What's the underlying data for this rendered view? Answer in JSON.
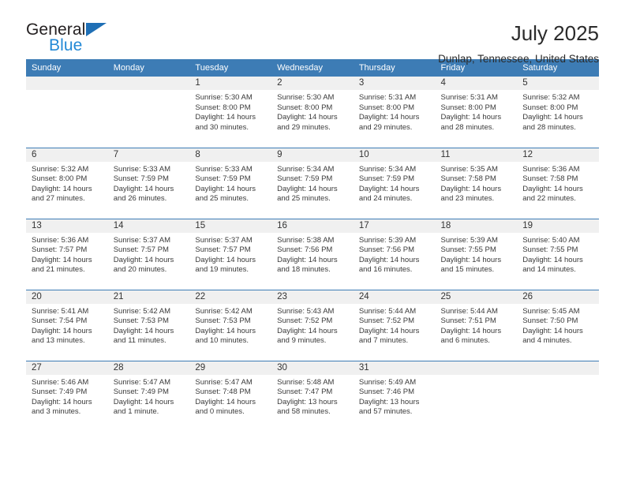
{
  "branding": {
    "word_one": "General",
    "word_two": "Blue",
    "triangle_color": "#1f6fb5",
    "blue_text_color": "#2389d6",
    "dark_text_color": "#231f20"
  },
  "header": {
    "title": "July 2025",
    "subtitle": "Dunlap, Tennessee, United States"
  },
  "theme": {
    "header_blue": "#3d7cb5",
    "daynum_band": "#f0f0f0",
    "text": "#3a3a3a"
  },
  "calendar": {
    "weekday_headers": [
      "Sunday",
      "Monday",
      "Tuesday",
      "Wednesday",
      "Thursday",
      "Friday",
      "Saturday"
    ],
    "weeks": [
      [
        {
          "day": "",
          "sunrise": "",
          "sunset": "",
          "daylight": ""
        },
        {
          "day": "",
          "sunrise": "",
          "sunset": "",
          "daylight": ""
        },
        {
          "day": "1",
          "sunrise": "Sunrise: 5:30 AM",
          "sunset": "Sunset: 8:00 PM",
          "daylight": "Daylight: 14 hours and 30 minutes."
        },
        {
          "day": "2",
          "sunrise": "Sunrise: 5:30 AM",
          "sunset": "Sunset: 8:00 PM",
          "daylight": "Daylight: 14 hours and 29 minutes."
        },
        {
          "day": "3",
          "sunrise": "Sunrise: 5:31 AM",
          "sunset": "Sunset: 8:00 PM",
          "daylight": "Daylight: 14 hours and 29 minutes."
        },
        {
          "day": "4",
          "sunrise": "Sunrise: 5:31 AM",
          "sunset": "Sunset: 8:00 PM",
          "daylight": "Daylight: 14 hours and 28 minutes."
        },
        {
          "day": "5",
          "sunrise": "Sunrise: 5:32 AM",
          "sunset": "Sunset: 8:00 PM",
          "daylight": "Daylight: 14 hours and 28 minutes."
        }
      ],
      [
        {
          "day": "6",
          "sunrise": "Sunrise: 5:32 AM",
          "sunset": "Sunset: 8:00 PM",
          "daylight": "Daylight: 14 hours and 27 minutes."
        },
        {
          "day": "7",
          "sunrise": "Sunrise: 5:33 AM",
          "sunset": "Sunset: 7:59 PM",
          "daylight": "Daylight: 14 hours and 26 minutes."
        },
        {
          "day": "8",
          "sunrise": "Sunrise: 5:33 AM",
          "sunset": "Sunset: 7:59 PM",
          "daylight": "Daylight: 14 hours and 25 minutes."
        },
        {
          "day": "9",
          "sunrise": "Sunrise: 5:34 AM",
          "sunset": "Sunset: 7:59 PM",
          "daylight": "Daylight: 14 hours and 25 minutes."
        },
        {
          "day": "10",
          "sunrise": "Sunrise: 5:34 AM",
          "sunset": "Sunset: 7:59 PM",
          "daylight": "Daylight: 14 hours and 24 minutes."
        },
        {
          "day": "11",
          "sunrise": "Sunrise: 5:35 AM",
          "sunset": "Sunset: 7:58 PM",
          "daylight": "Daylight: 14 hours and 23 minutes."
        },
        {
          "day": "12",
          "sunrise": "Sunrise: 5:36 AM",
          "sunset": "Sunset: 7:58 PM",
          "daylight": "Daylight: 14 hours and 22 minutes."
        }
      ],
      [
        {
          "day": "13",
          "sunrise": "Sunrise: 5:36 AM",
          "sunset": "Sunset: 7:57 PM",
          "daylight": "Daylight: 14 hours and 21 minutes."
        },
        {
          "day": "14",
          "sunrise": "Sunrise: 5:37 AM",
          "sunset": "Sunset: 7:57 PM",
          "daylight": "Daylight: 14 hours and 20 minutes."
        },
        {
          "day": "15",
          "sunrise": "Sunrise: 5:37 AM",
          "sunset": "Sunset: 7:57 PM",
          "daylight": "Daylight: 14 hours and 19 minutes."
        },
        {
          "day": "16",
          "sunrise": "Sunrise: 5:38 AM",
          "sunset": "Sunset: 7:56 PM",
          "daylight": "Daylight: 14 hours and 18 minutes."
        },
        {
          "day": "17",
          "sunrise": "Sunrise: 5:39 AM",
          "sunset": "Sunset: 7:56 PM",
          "daylight": "Daylight: 14 hours and 16 minutes."
        },
        {
          "day": "18",
          "sunrise": "Sunrise: 5:39 AM",
          "sunset": "Sunset: 7:55 PM",
          "daylight": "Daylight: 14 hours and 15 minutes."
        },
        {
          "day": "19",
          "sunrise": "Sunrise: 5:40 AM",
          "sunset": "Sunset: 7:55 PM",
          "daylight": "Daylight: 14 hours and 14 minutes."
        }
      ],
      [
        {
          "day": "20",
          "sunrise": "Sunrise: 5:41 AM",
          "sunset": "Sunset: 7:54 PM",
          "daylight": "Daylight: 14 hours and 13 minutes."
        },
        {
          "day": "21",
          "sunrise": "Sunrise: 5:42 AM",
          "sunset": "Sunset: 7:53 PM",
          "daylight": "Daylight: 14 hours and 11 minutes."
        },
        {
          "day": "22",
          "sunrise": "Sunrise: 5:42 AM",
          "sunset": "Sunset: 7:53 PM",
          "daylight": "Daylight: 14 hours and 10 minutes."
        },
        {
          "day": "23",
          "sunrise": "Sunrise: 5:43 AM",
          "sunset": "Sunset: 7:52 PM",
          "daylight": "Daylight: 14 hours and 9 minutes."
        },
        {
          "day": "24",
          "sunrise": "Sunrise: 5:44 AM",
          "sunset": "Sunset: 7:52 PM",
          "daylight": "Daylight: 14 hours and 7 minutes."
        },
        {
          "day": "25",
          "sunrise": "Sunrise: 5:44 AM",
          "sunset": "Sunset: 7:51 PM",
          "daylight": "Daylight: 14 hours and 6 minutes."
        },
        {
          "day": "26",
          "sunrise": "Sunrise: 5:45 AM",
          "sunset": "Sunset: 7:50 PM",
          "daylight": "Daylight: 14 hours and 4 minutes."
        }
      ],
      [
        {
          "day": "27",
          "sunrise": "Sunrise: 5:46 AM",
          "sunset": "Sunset: 7:49 PM",
          "daylight": "Daylight: 14 hours and 3 minutes."
        },
        {
          "day": "28",
          "sunrise": "Sunrise: 5:47 AM",
          "sunset": "Sunset: 7:49 PM",
          "daylight": "Daylight: 14 hours and 1 minute."
        },
        {
          "day": "29",
          "sunrise": "Sunrise: 5:47 AM",
          "sunset": "Sunset: 7:48 PM",
          "daylight": "Daylight: 14 hours and 0 minutes."
        },
        {
          "day": "30",
          "sunrise": "Sunrise: 5:48 AM",
          "sunset": "Sunset: 7:47 PM",
          "daylight": "Daylight: 13 hours and 58 minutes."
        },
        {
          "day": "31",
          "sunrise": "Sunrise: 5:49 AM",
          "sunset": "Sunset: 7:46 PM",
          "daylight": "Daylight: 13 hours and 57 minutes."
        },
        {
          "day": "",
          "sunrise": "",
          "sunset": "",
          "daylight": ""
        },
        {
          "day": "",
          "sunrise": "",
          "sunset": "",
          "daylight": ""
        }
      ]
    ]
  }
}
